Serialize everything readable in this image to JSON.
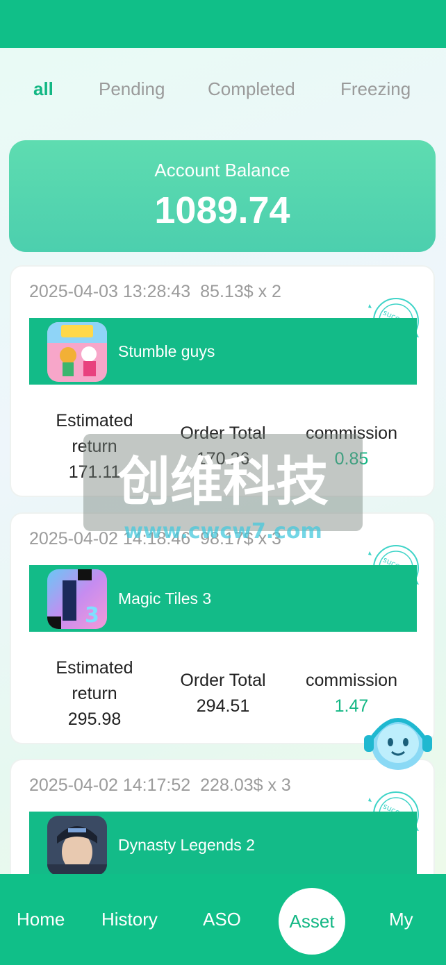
{
  "tabs": [
    {
      "label": "all",
      "active": true
    },
    {
      "label": "Pending",
      "active": false
    },
    {
      "label": "Completed",
      "active": false
    },
    {
      "label": "Freezing",
      "active": false
    }
  ],
  "balance": {
    "label": "Account Balance",
    "value": "1089.74"
  },
  "orders": [
    {
      "datetime": "2025-04-03 13:28:43",
      "amount": "85.13$ x 2",
      "game": "Stumble guys",
      "icon": "stumble-guys-icon",
      "estimated_label": "Estimated return",
      "estimated_value": "171.11",
      "total_label": "Order Total",
      "total_value": "170.26",
      "commission_label": "commission",
      "commission_value": "0.85",
      "stamp": "success"
    },
    {
      "datetime": "2025-04-02 14:18:46",
      "amount": "98.17$ x 3",
      "game": "Magic Tiles 3",
      "icon": "magic-tiles-icon",
      "estimated_label": "Estimated return",
      "estimated_value": "295.98",
      "total_label": "Order Total",
      "total_value": "294.51",
      "commission_label": "commission",
      "commission_value": "1.47",
      "stamp": "success"
    },
    {
      "datetime": "2025-04-02 14:17:52",
      "amount": "228.03$ x 3",
      "game": "Dynasty Legends 2",
      "icon": "dynasty-legends-icon",
      "stamp": "success"
    }
  ],
  "watermark": {
    "text": "创维科技",
    "url": "www.cwcw7.com"
  },
  "nav": [
    {
      "label": "Home",
      "active": false
    },
    {
      "label": "History",
      "active": false
    },
    {
      "label": "ASO",
      "active": false
    },
    {
      "label": "Asset",
      "active": true
    },
    {
      "label": "My",
      "active": false
    }
  ],
  "colors": {
    "primary": "#10bf88",
    "accent_text": "#13b784",
    "balance_card": "#5edcb0"
  }
}
